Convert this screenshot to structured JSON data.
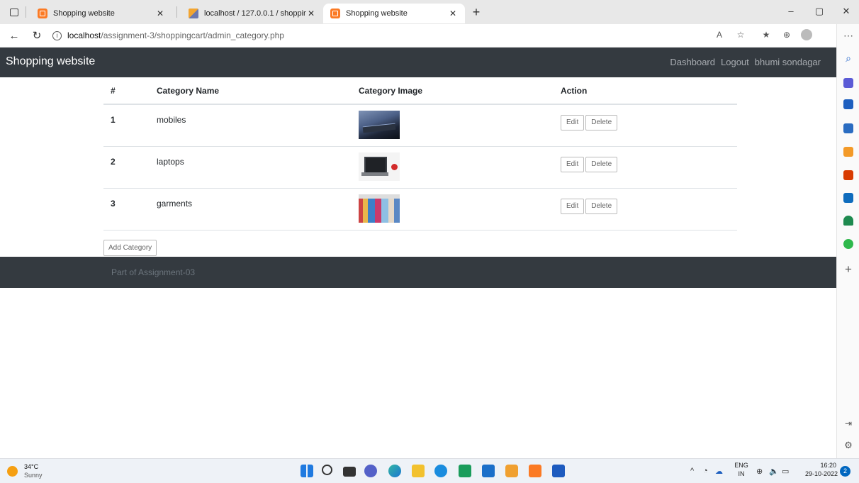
{
  "browser": {
    "tabs": [
      {
        "title": "Shopping website"
      },
      {
        "title": "localhost / 127.0.0.1 / shoppingc"
      },
      {
        "title": "Shopping website"
      }
    ],
    "new_tab": "+",
    "url_host": "localhost",
    "url_path": "/assignment-3/shoppingcart/admin_category.php",
    "window_controls": [
      "–",
      "▢",
      "✕"
    ]
  },
  "site": {
    "brand": "Shopping website",
    "nav": [
      "Dashboard",
      "Logout",
      "bhumi sondagar"
    ]
  },
  "table": {
    "headers": [
      "#",
      "Category Name",
      "Category Image",
      "Action"
    ],
    "rows": [
      {
        "id": "1",
        "name": "mobiles"
      },
      {
        "id": "2",
        "name": "laptops"
      },
      {
        "id": "3",
        "name": "garments"
      }
    ],
    "edit_label": "Edit",
    "delete_label": "Delete"
  },
  "add_category_label": "Add Category",
  "footer_text": "Part of Assignment-03",
  "taskbar": {
    "temperature": "34°C",
    "condition": "Sunny",
    "lang_top": "ENG",
    "lang_bottom": "IN",
    "time": "16:20",
    "date": "29-10-2022",
    "notification_count": "2"
  },
  "colors": {
    "navbar_bg": "#343a40",
    "footer_bg": "#343a40",
    "xampp_orange": "#fb7a24"
  }
}
